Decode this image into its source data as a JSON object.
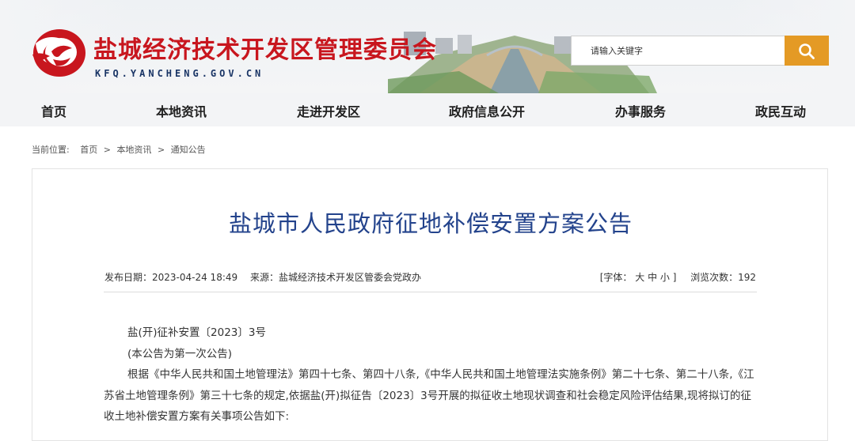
{
  "header": {
    "site_title": "盐城经济技术开发区管理委员会",
    "site_url": "KFQ.YANCHENG.GOV.CN",
    "brand_color": "#c8161e"
  },
  "search": {
    "placeholder": "请输入关键字",
    "button_icon": "search-icon",
    "button_color": "#e49a25"
  },
  "nav": {
    "items": [
      "首页",
      "本地资讯",
      "走进开发区",
      "政府信息公开",
      "办事服务",
      "政民互动"
    ]
  },
  "breadcrumb": {
    "prefix": "当前位置:",
    "items": [
      "首页",
      "本地资讯",
      "通知公告"
    ],
    "separator": ">"
  },
  "article": {
    "title": "盐城市人民政府征地补偿安置方案公告",
    "publish_date": "发布日期：2023-04-24 18:49",
    "source": "来源：盐城经济技术开发区管委会党政办",
    "font_size_label": "[字体：",
    "font_sizes": [
      "大",
      "中",
      "小"
    ],
    "font_size_close": "]",
    "views": "浏览次数：192",
    "doc_number": "盐(开)征补安置〔2023〕3号",
    "notice": "(本公告为第一次公告)",
    "paragraph": "根据《中华人民共和国土地管理法》第四十七条、第四十八条,《中华人民共和国土地管理法实施条例》第二十七条、第二十八条,《江苏省土地管理条例》第三十七条的规定,依据盐(开)拟征告〔2023〕3号开展的拟征收土地现状调查和社会稳定风险评估结果,现将拟订的征收土地补偿安置方案有关事项公告如下:",
    "title_color": "#23438c"
  }
}
